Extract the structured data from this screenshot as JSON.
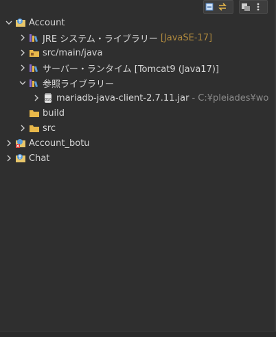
{
  "toolbar": {
    "buttons": [
      "collapse-all-icon",
      "link-with-editor-icon",
      "filters-icon",
      "view-menu-icon"
    ]
  },
  "tree": {
    "items": [
      {
        "label": "Account",
        "expanded": true
      },
      {
        "label": "JRE システム・ライブラリー",
        "decoration": "[JavaSE-17]"
      },
      {
        "label": "src/main/java"
      },
      {
        "label": "サーバー・ランタイム [Tomcat9 (Java17)]"
      },
      {
        "label": "参照ライブラリー",
        "expanded": true
      },
      {
        "label": "mariadb-java-client-2.7.11.jar",
        "decoration": "- C:¥pleiades¥wo"
      },
      {
        "label": "build"
      },
      {
        "label": "src"
      },
      {
        "label": "Account_botu"
      },
      {
        "label": "Chat"
      }
    ]
  },
  "colors": {
    "background": "#2f2f2f",
    "text": "#d6d6d6",
    "decoration": "#b08a3e",
    "folder": "#e8b84a"
  }
}
